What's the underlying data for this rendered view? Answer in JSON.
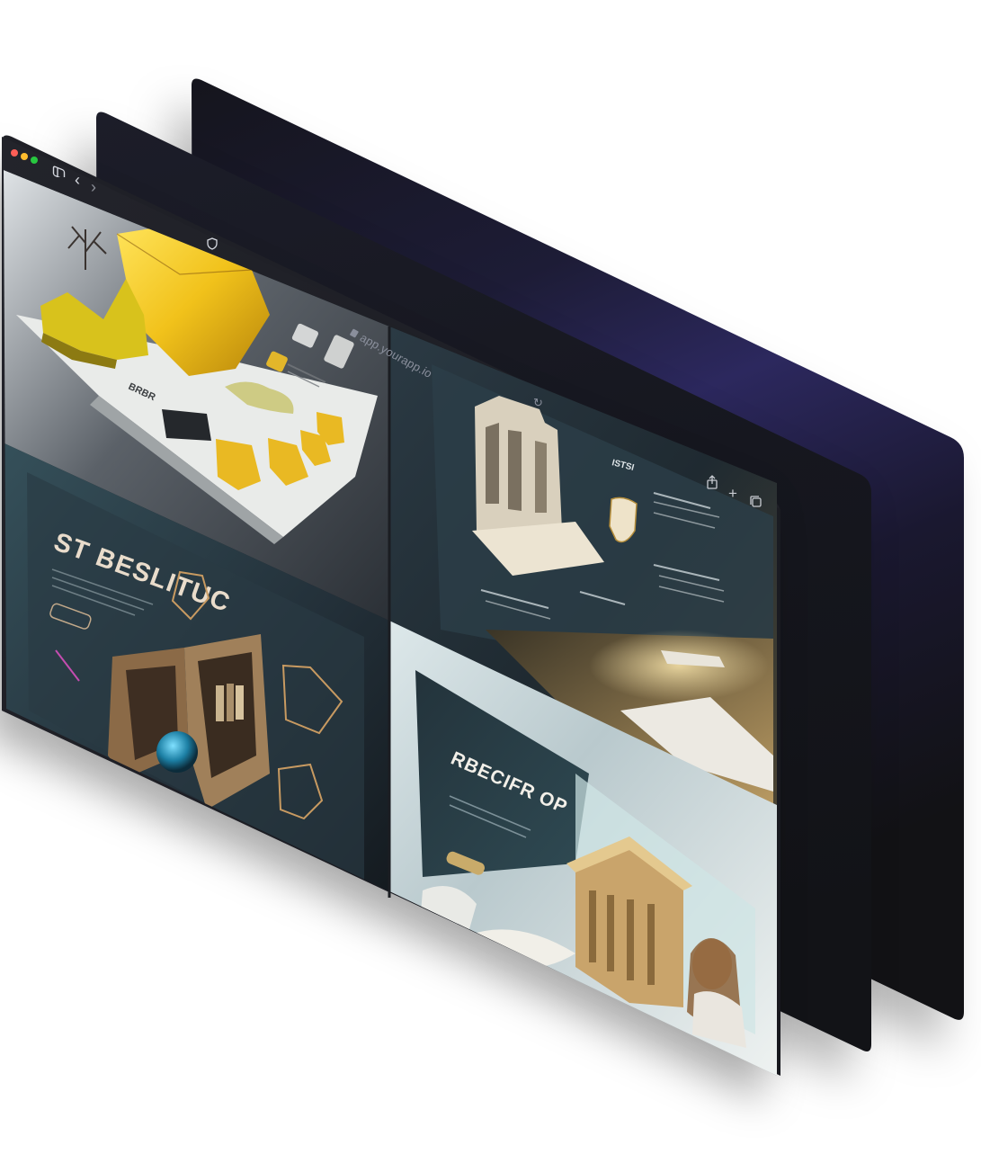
{
  "browser": {
    "url": "app.yourapp.io",
    "traffic_lights": {
      "close": "#ff5f57",
      "minimize": "#febc2e",
      "maximize": "#28c840"
    },
    "icons": {
      "sidebar": "sidebar-toggle-icon",
      "back": "chevron-left-icon",
      "forward": "chevron-right-icon",
      "shield": "shield-icon",
      "lock": "lock-icon",
      "reload": "reload-icon",
      "share": "share-icon",
      "new_tab": "plus-icon",
      "tabs": "tabs-overview-icon"
    },
    "glyphs": {
      "back": "‹",
      "forward": "›",
      "new_tab": "+",
      "reload": "↻"
    }
  },
  "screens": {
    "top_left": {
      "caption": "BRBR"
    },
    "bottom_left": {
      "headline": "ST BESLITUC"
    },
    "top_right": {
      "heading": "ISTSI"
    },
    "bottom_right": {
      "headline": "RBECIFR OP"
    }
  },
  "colors": {
    "window_back": "#1b1c2a",
    "window_mid": "#171821",
    "window_front": "#1c1d23",
    "accent_purple": "#2d2760",
    "gem_yellow": "#f1c21b",
    "teal": "#2d4a57",
    "light_sky": "#d7e3e6"
  }
}
